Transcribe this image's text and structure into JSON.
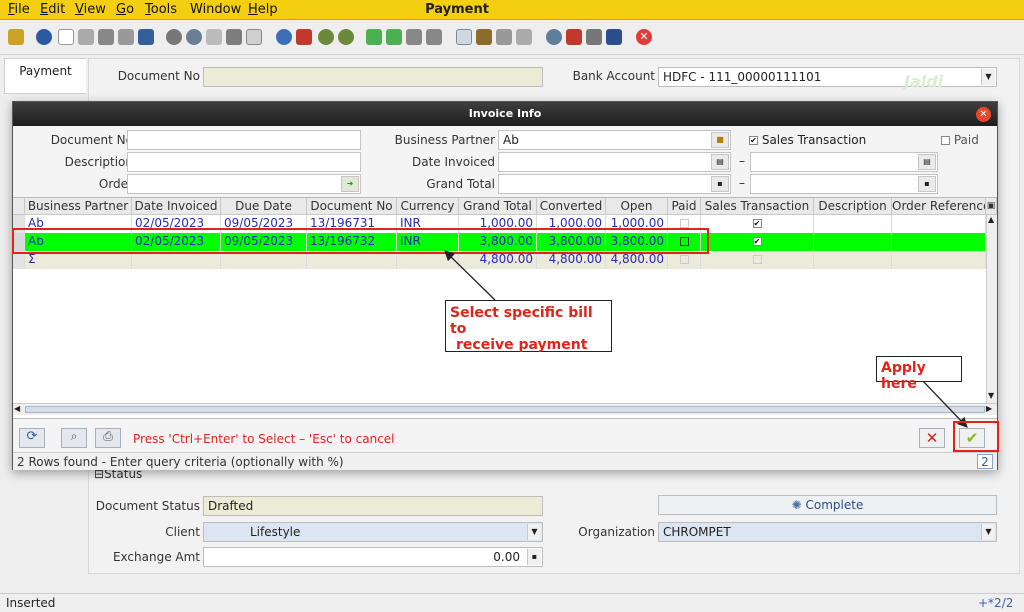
{
  "menu": {
    "items": [
      "File",
      "Edit",
      "View",
      "Go",
      "Tools",
      "Window",
      "Help"
    ],
    "underline": [
      "F",
      "E",
      "V",
      "G",
      "T",
      "",
      "H"
    ],
    "title": "Payment"
  },
  "toolbar": {
    "icons": [
      "undo-icon",
      "help-icon",
      "new-icon",
      "copy-icon",
      "delete-icon",
      "delete-selection-icon",
      "save-icon",
      "refresh-icon",
      "find-icon",
      "attachment-icon",
      "chat-icon",
      "grid-toggle-icon",
      "history-icon",
      "home-icon",
      "back-icon",
      "forward-icon",
      "first-record-icon",
      "previous-record-icon",
      "next-record-icon",
      "last-record-icon",
      "report-icon",
      "archive-icon",
      "print-icon",
      "print-preview-icon",
      "zoom-across-icon",
      "workflow-icon",
      "request-icon",
      "product-info-icon",
      "close-window-icon"
    ]
  },
  "tab": {
    "label": "Payment"
  },
  "form": {
    "document_no_label": "Document No",
    "document_no_value": "",
    "bank_account_label": "Bank Account",
    "bank_account_value": "HDFC - 111_00000111101",
    "status_section_label": "Status",
    "document_status_label": "Document Status",
    "document_status_value": "Drafted",
    "complete_button": "Complete",
    "client_label": "Client",
    "client_value": "Lifestyle",
    "organization_label": "Organization",
    "organization_value": "CHROMPET",
    "exchange_amt_label": "Exchange Amt",
    "exchange_amt_value": "0.00",
    "watermark": "Jaldi"
  },
  "dialog": {
    "title": "Invoice Info",
    "document_no_label": "Document No",
    "description_label": "Description",
    "order_label": "Order",
    "business_partner_label": "Business Partner",
    "business_partner_value": "Ab",
    "date_invoiced_label": "Date Invoiced",
    "grand_total_label": "Grand Total",
    "range_sep": "–",
    "sales_transaction_label": "Sales Transaction",
    "paid_label": "Paid",
    "columns": [
      "Business Partner",
      "Date Invoiced",
      "Due Date",
      "Document No",
      "Currency",
      "Grand Total",
      "Converted",
      "Open",
      "Paid",
      "Sales Transaction",
      "Description",
      "Order Reference"
    ],
    "rows": [
      {
        "bp": "Ab",
        "date_invoiced": "02/05/2023",
        "due_date": "09/05/2023",
        "doc_no": "13/196731",
        "currency": "INR",
        "grand_total": "1,000.00",
        "converted": "1,000.00",
        "open": "1,000.00",
        "paid": false,
        "sales": true
      },
      {
        "bp": "Ab",
        "date_invoiced": "02/05/2023",
        "due_date": "09/05/2023",
        "doc_no": "13/196732",
        "currency": "INR",
        "grand_total": "3,800.00",
        "converted": "3,800.00",
        "open": "3,800.00",
        "paid": false,
        "sales": true
      }
    ],
    "total_row": {
      "bp": "Σ",
      "grand_total": "4,800.00",
      "converted": "4,800.00",
      "open": "4,800.00"
    },
    "hint": "Press 'Ctrl+Enter' to Select – 'Esc' to cancel",
    "status_text": "2 Rows found - Enter query criteria (optionally with %)",
    "status_count": "2"
  },
  "annotations": {
    "select_bill_line1": "Select specific bill to",
    "select_bill_line2": "receive payment",
    "apply_here": "Apply here"
  },
  "statusbar": {
    "left": "Inserted",
    "right": "+*2/2"
  },
  "colors": {
    "menubar": "#f4ce10",
    "selected_row": "#00ff00",
    "annotation_red": "#e2231a"
  }
}
